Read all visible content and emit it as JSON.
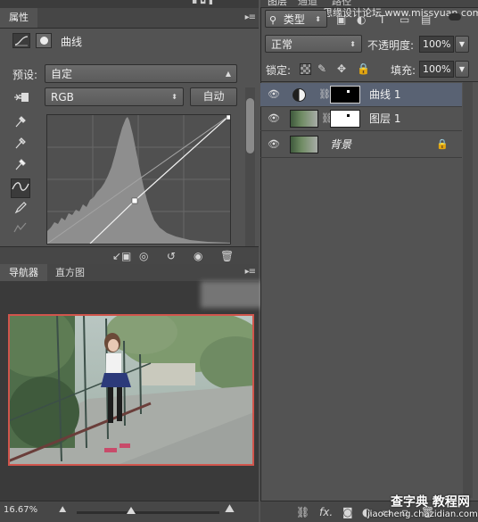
{
  "properties_panel": {
    "tab_label": "属性",
    "adjustment_name": "曲线",
    "preset_label": "预设:",
    "preset_value": "自定",
    "channel_value": "RGB",
    "auto_button": "自动"
  },
  "navigator_panel": {
    "tab_navigator": "导航器",
    "tab_histogram": "直方图",
    "zoom_value": "16.67%"
  },
  "layers_panel": {
    "tab_layers": "图层",
    "tab_channels": "通道",
    "tab_paths": "路径",
    "filter_kind": "类型",
    "blend_mode": "正常",
    "opacity_label": "不透明度:",
    "opacity_value": "100%",
    "lock_label": "锁定:",
    "fill_label": "填充:",
    "fill_value": "100%",
    "layers": [
      {
        "name": "曲线 1",
        "selected": true
      },
      {
        "name": "图层 1",
        "selected": false
      },
      {
        "name": "背景",
        "selected": false
      }
    ]
  },
  "watermark": {
    "top_right": "思缘设计论坛 www.missyuan.com",
    "bottom_right_1": "查字典 教程网",
    "bottom_right_2": "jiaocheng.chazidian.com"
  },
  "colors": {
    "panel_bg": "#535353",
    "selected_layer": "#596273",
    "navigator_frame": "#d0554c"
  }
}
